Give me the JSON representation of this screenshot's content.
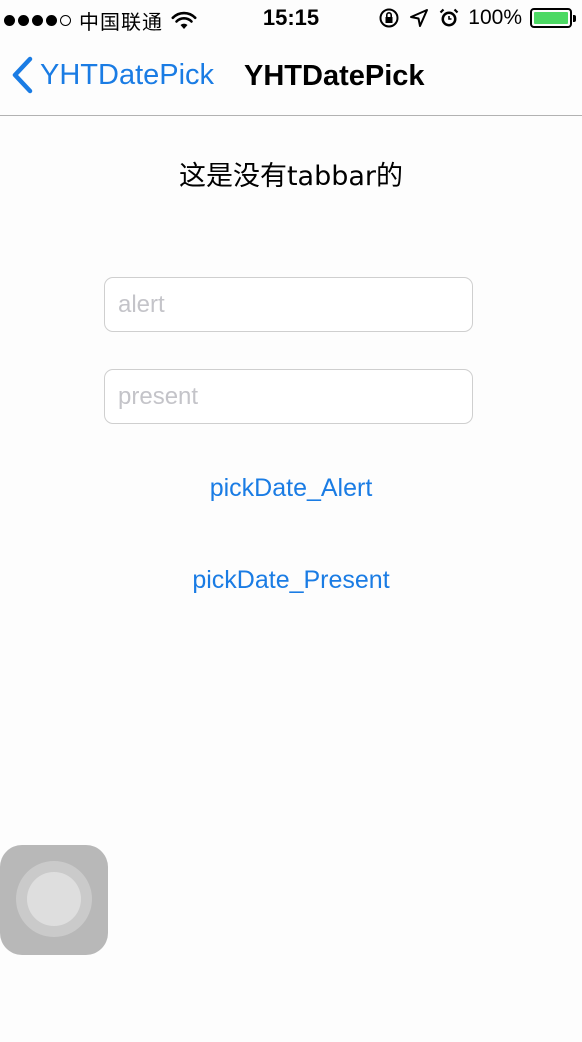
{
  "status_bar": {
    "carrier": "中国联通",
    "time": "15:15",
    "battery_percent": "100%",
    "battery_level": 1.0,
    "signal_bars_filled": 4,
    "signal_bars_total": 5,
    "battery_color": "#4cd964"
  },
  "nav": {
    "back_label": "YHTDatePick",
    "title": "YHTDatePick",
    "accent_color": "#1a7ce4"
  },
  "main": {
    "heading": "这是没有tabbar的",
    "alert_field": {
      "placeholder": "alert",
      "value": ""
    },
    "present_field": {
      "placeholder": "present",
      "value": ""
    },
    "alert_button_label": "pickDate_Alert",
    "present_button_label": "pickDate_Present"
  },
  "icons": {
    "wifi": "wifi-icon",
    "orientation_lock": "orientation-lock-icon",
    "location": "location-arrow-icon",
    "alarm": "alarm-clock-icon",
    "back": "chevron-left-icon",
    "assistive_touch": "assistive-touch-icon"
  }
}
